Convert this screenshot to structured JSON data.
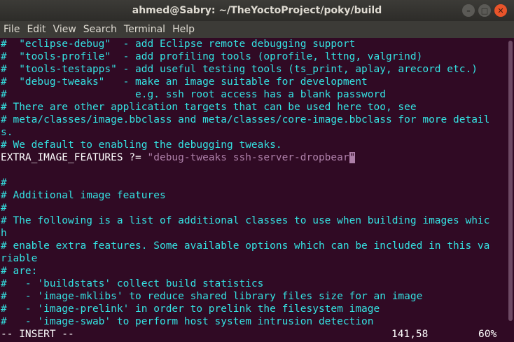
{
  "window": {
    "title": "ahmed@Sabry: ~/TheYoctoProject/poky/build",
    "controls": {
      "minimize": "–",
      "maximize": "□",
      "close": "✕"
    }
  },
  "menu": {
    "items": [
      "File",
      "Edit",
      "View",
      "Search",
      "Terminal",
      "Help"
    ]
  },
  "editor": {
    "lines": [
      "#  \"eclipse-debug\"  - add Eclipse remote debugging support",
      "#  \"tools-profile\"  - add profiling tools (oprofile, lttng, valgrind)",
      "#  \"tools-testapps\" - add useful testing tools (ts_print, aplay, arecord etc.)",
      "#  \"debug-tweaks\"   - make an image suitable for development",
      "#                     e.g. ssh root access has a blank password",
      "# There are other application targets that can be used here too, see",
      "# meta/classes/image.bbclass and meta/classes/core-image.bbclass for more detail",
      "s.",
      "# We default to enabling the debugging tweaks."
    ],
    "var_line": {
      "key": "EXTRA_IMAGE_FEATURES ?= ",
      "value": "\"debug-tweaks ssh-server-dropbear",
      "cursor_char": "\""
    },
    "lines2": [
      "",
      "#",
      "# Additional image features",
      "#",
      "# The following is a list of additional classes to use when building images whic",
      "h",
      "# enable extra features. Some available options which can be included in this va",
      "riable",
      "# are:",
      "#   - 'buildstats' collect build statistics",
      "#   - 'image-mklibs' to reduce shared library files size for an image",
      "#   - 'image-prelink' in order to prelink the filesystem image",
      "#   - 'image-swab' to perform host system intrusion detection"
    ],
    "status": {
      "mode": "-- INSERT --",
      "position": "141,58",
      "percent": "60%"
    }
  }
}
